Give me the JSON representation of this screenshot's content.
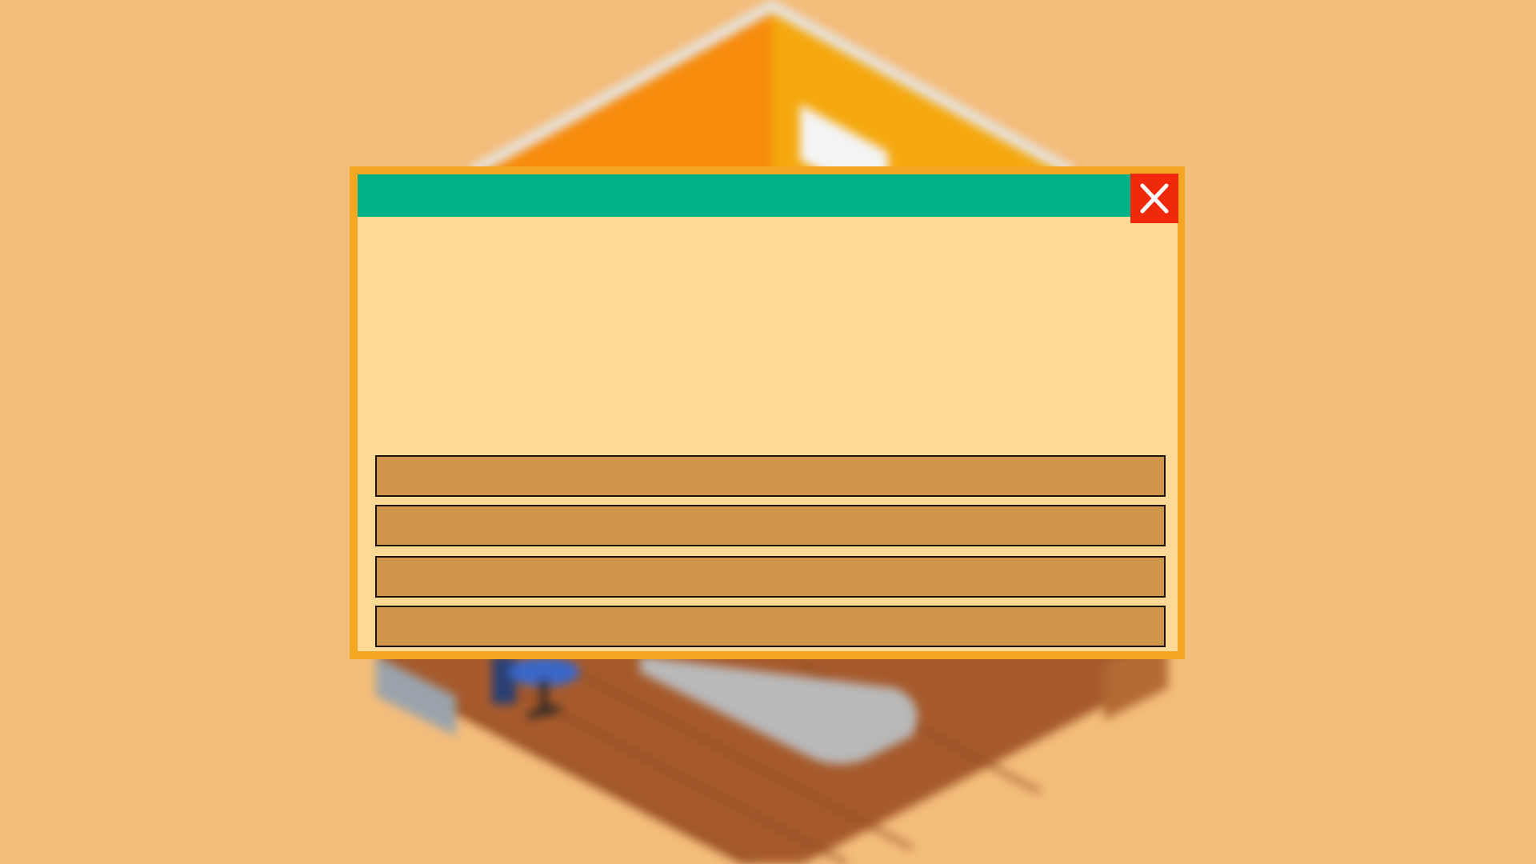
{
  "colors": {
    "background": "#f3bd7b",
    "dialog_border": "#f5a623",
    "dialog_fill": "#ffd995",
    "titlebar": "#00b185",
    "close_button": "#f0290a",
    "option_fill": "#cf9649"
  },
  "dialog": {
    "title": "",
    "close_icon": "x-icon",
    "body_text": "",
    "options": [
      {
        "label": ""
      },
      {
        "label": ""
      },
      {
        "label": ""
      },
      {
        "label": ""
      }
    ]
  }
}
